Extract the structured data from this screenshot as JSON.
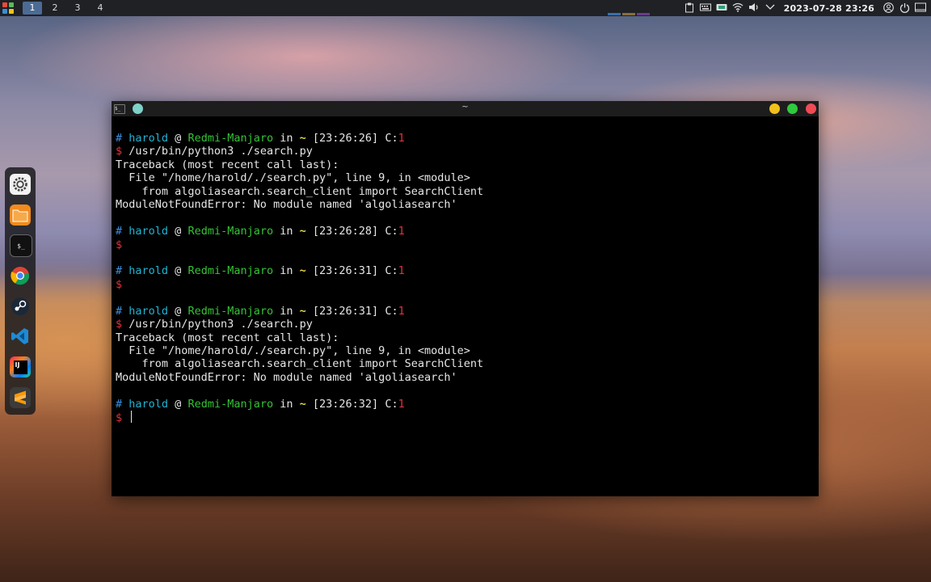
{
  "panel": {
    "workspaces": [
      "1",
      "2",
      "3",
      "4"
    ],
    "active_workspace": "1",
    "clock": "2023-07-28 23:26"
  },
  "dock": {
    "items": [
      "settings",
      "files",
      "terminal",
      "chrome",
      "steam",
      "vscode",
      "intellij",
      "sublime"
    ]
  },
  "terminal": {
    "title": "~",
    "icon_text": "$_",
    "prompt_user": "harold",
    "prompt_host": "Redmi-Manjaro",
    "prompt_dir": "~",
    "prompt_exit_label": "C:",
    "blocks": [
      {
        "time": "[23:26:26]",
        "exit": "1",
        "command": "/usr/bin/python3 ./search.py",
        "output": [
          "Traceback (most recent call last):",
          "  File \"/home/harold/./search.py\", line 9, in <module>",
          "    from algoliasearch.search_client import SearchClient",
          "ModuleNotFoundError: No module named 'algoliasearch'"
        ]
      },
      {
        "time": "[23:26:28]",
        "exit": "1",
        "command": "",
        "output": []
      },
      {
        "time": "[23:26:31]",
        "exit": "1",
        "command": "",
        "output": []
      },
      {
        "time": "[23:26:31]",
        "exit": "1",
        "command": "/usr/bin/python3 ./search.py",
        "output": [
          "Traceback (most recent call last):",
          "  File \"/home/harold/./search.py\", line 9, in <module>",
          "    from algoliasearch.search_client import SearchClient",
          "ModuleNotFoundError: No module named 'algoliasearch'"
        ]
      },
      {
        "time": "[23:26:32]",
        "exit": "1",
        "command": "",
        "output": [],
        "active": true
      }
    ]
  },
  "colors": {
    "panel_bg": "#1f2125",
    "workspace_active": "#4c6b94",
    "terminal_bg": "#000000",
    "prompt_user": "#1fb4d4",
    "prompt_host": "#35c335",
    "prompt_tilde": "#e6d84a",
    "prompt_error": "#e0323a",
    "btn_minimize": "#f2c01d",
    "btn_maximize": "#2fca3d",
    "btn_close": "#f04b55"
  }
}
